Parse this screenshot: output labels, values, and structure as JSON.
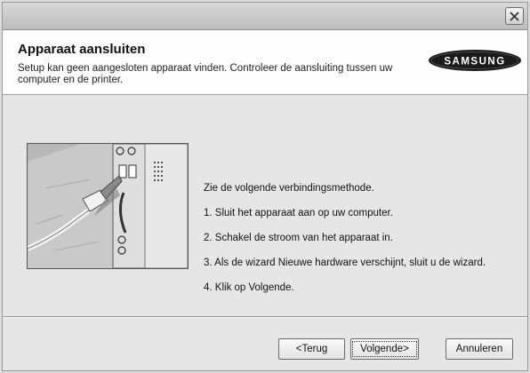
{
  "header": {
    "title": "Apparaat aansluiten",
    "subtitle": "Setup kan geen aangesloten apparaat vinden. Controleer de aansluiting tussen uw computer en de printer.",
    "logo_text": "SAMSUNG"
  },
  "instructions": [
    "Zie de volgende verbindingsmethode.",
    "1. Sluit het apparaat aan op uw computer.",
    "2. Schakel de stroom van het apparaat in.",
    "3. Als de wizard Nieuwe hardware verschijnt, sluit u de wizard.",
    "4. Klik op Volgende."
  ],
  "buttons": {
    "back": "<Terug",
    "next": "Volgende>",
    "cancel": "Annuleren"
  },
  "icons": {
    "close": "close-icon",
    "illustration": "usb-connection-illustration"
  }
}
